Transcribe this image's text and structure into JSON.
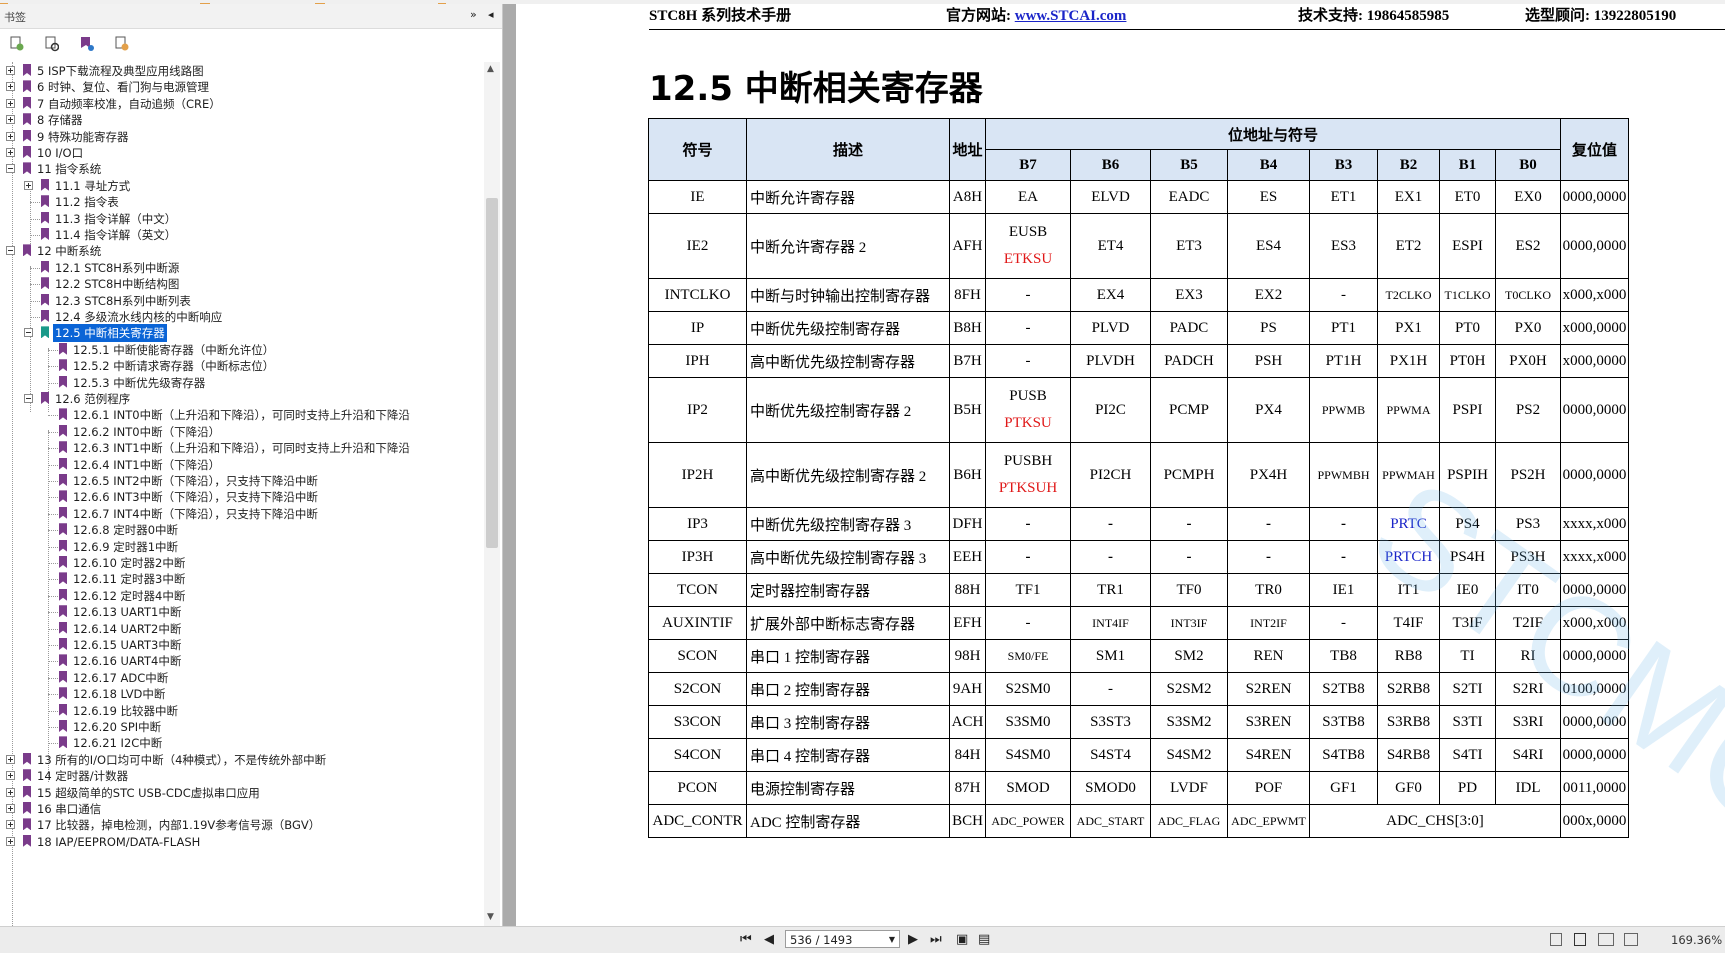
{
  "bookmarks": {
    "title": "书签",
    "collapse_icon": "»",
    "close_icon": "◂",
    "items": [
      {
        "label": "5  ISP下载流程及典型应用线路图"
      },
      {
        "label": "6  时钟、复位、看门狗与电源管理"
      },
      {
        "label": "7  自动频率校准，自动追频（CRE）"
      },
      {
        "label": "8  存储器"
      },
      {
        "label": "9  特殊功能寄存器"
      },
      {
        "label": "10  I/O口"
      },
      {
        "label": "11  指令系统"
      },
      {
        "label": "11.1 寻址方式"
      },
      {
        "label": "11.2 指令表"
      },
      {
        "label": "11.3 指令详解（中文）"
      },
      {
        "label": "11.4 指令详解（英文）"
      },
      {
        "label": "12  中断系统"
      },
      {
        "label": "12.1 STC8H系列中断源"
      },
      {
        "label": "12.2  STC8H中断结构图"
      },
      {
        "label": "12.3  STC8H系列中断列表"
      },
      {
        "label": "12.4  多级流水线内核的中断响应"
      },
      {
        "label": "12.5  中断相关寄存器"
      },
      {
        "label": "12.5.1 中断使能寄存器（中断允许位）"
      },
      {
        "label": "12.5.2 中断请求寄存器（中断标志位）"
      },
      {
        "label": "12.5.3 中断优先级寄存器"
      },
      {
        "label": "12.6  范例程序"
      },
      {
        "label": "12.6.1 INT0中断（上升沿和下降沿），可同时支持上升沿和下降沿"
      },
      {
        "label": "12.6.2 INT0中断（下降沿）"
      },
      {
        "label": "12.6.3 INT1中断（上升沿和下降沿），可同时支持上升沿和下降沿"
      },
      {
        "label": "12.6.4 INT1中断（下降沿）"
      },
      {
        "label": "12.6.5 INT2中断（下降沿），只支持下降沿中断"
      },
      {
        "label": "12.6.6 INT3中断（下降沿），只支持下降沿中断"
      },
      {
        "label": "12.6.7 INT4中断（下降沿），只支持下降沿中断"
      },
      {
        "label": "12.6.8 定时器0中断"
      },
      {
        "label": "12.6.9 定时器1中断"
      },
      {
        "label": "12.6.10 定时器2中断"
      },
      {
        "label": "12.6.11 定时器3中断"
      },
      {
        "label": "12.6.12 定时器4中断"
      },
      {
        "label": "12.6.13 UART1中断"
      },
      {
        "label": "12.6.14 UART2中断"
      },
      {
        "label": "12.6.15 UART3中断"
      },
      {
        "label": "12.6.16 UART4中断"
      },
      {
        "label": "12.6.17 ADC中断"
      },
      {
        "label": "12.6.18 LVD中断"
      },
      {
        "label": "12.6.19 比较器中断"
      },
      {
        "label": "12.6.20 SPI中断"
      },
      {
        "label": "12.6.21 I2C中断"
      },
      {
        "label": "13  所有的I/O口均可中断（4种模式），不是传统外部中断"
      },
      {
        "label": "14  定时器/计数器"
      },
      {
        "label": "15  超级简单的STC USB-CDC虚拟串口应用"
      },
      {
        "label": "16  串口通信"
      },
      {
        "label": "17  比较器，掉电检测，内部1.19V参考信号源（BGV）"
      },
      {
        "label": "18  IAP/EEPROM/DATA-FLASH"
      }
    ]
  },
  "document": {
    "header": {
      "manual": "STC8H 系列技术手册",
      "site_label": "官方网站: ",
      "site_url": "www.STCAI.com",
      "support": "技术支持: 19864585985",
      "advisor": "选型顾问: 13922805190"
    },
    "section_title": "12.5   中断相关寄存器",
    "watermark": "STCMCU",
    "table": {
      "headers": {
        "symbol": "符号",
        "desc": "描述",
        "addr": "地址",
        "bits_group": "位地址与符号",
        "reset": "复位值",
        "bits": [
          "B7",
          "B6",
          "B5",
          "B4",
          "B3",
          "B2",
          "B1",
          "B0"
        ]
      },
      "rows": [
        {
          "sym": "IE",
          "desc": "中断允许寄存器",
          "addr": "A8H",
          "bits": [
            "EA",
            "ELVD",
            "EADC",
            "ES",
            "ET1",
            "EX1",
            "ET0",
            "EX0"
          ],
          "reset": "0000,0000"
        },
        {
          "sym": "IE2",
          "desc": "中断允许寄存器 2",
          "addr": "AFH",
          "b7": "EUSB",
          "b7_red": "ETKSU",
          "bits": [
            "",
            "ET4",
            "ET3",
            "ES4",
            "ES3",
            "ET2",
            "ESPI",
            "ES2"
          ],
          "reset": "0000,0000"
        },
        {
          "sym": "INTCLKO",
          "desc": "中断与时钟输出控制寄存器",
          "addr": "8FH",
          "bits": [
            "-",
            "EX4",
            "EX3",
            "EX2",
            "-",
            "T2CLKO",
            "T1CLKO",
            "T0CLKO"
          ],
          "reset": "x000,x000"
        },
        {
          "sym": "IP",
          "desc": "中断优先级控制寄存器",
          "addr": "B8H",
          "bits": [
            "-",
            "PLVD",
            "PADC",
            "PS",
            "PT1",
            "PX1",
            "PT0",
            "PX0"
          ],
          "reset": "x000,0000"
        },
        {
          "sym": "IPH",
          "desc": "高中断优先级控制寄存器",
          "addr": "B7H",
          "bits": [
            "-",
            "PLVDH",
            "PADCH",
            "PSH",
            "PT1H",
            "PX1H",
            "PT0H",
            "PX0H"
          ],
          "reset": "x000,0000"
        },
        {
          "sym": "IP2",
          "desc": "中断优先级控制寄存器 2",
          "addr": "B5H",
          "b7": "PUSB",
          "b7_red": "PTKSU",
          "bits": [
            "",
            "PI2C",
            "PCMP",
            "PX4",
            "PPWMB",
            "PPWMA",
            "PSPI",
            "PS2"
          ],
          "reset": "0000,0000"
        },
        {
          "sym": "IP2H",
          "desc": "高中断优先级控制寄存器 2",
          "addr": "B6H",
          "b7": "PUSBH",
          "b7_red": "PTKSUH",
          "bits": [
            "",
            "PI2CH",
            "PCMPH",
            "PX4H",
            "PPWMBH",
            "PPWMAH",
            "PSPIH",
            "PS2H"
          ],
          "reset": "0000,0000"
        },
        {
          "sym": "IP3",
          "desc": "中断优先级控制寄存器 3",
          "addr": "DFH",
          "bits": [
            "-",
            "-",
            "-",
            "-",
            "-",
            "PRTC",
            "PS4",
            "PS3"
          ],
          "reset": "xxxx,x000"
        },
        {
          "sym": "IP3H",
          "desc": "高中断优先级控制寄存器 3",
          "addr": "EEH",
          "bits": [
            "-",
            "-",
            "-",
            "-",
            "-",
            "PRTCH",
            "PS4H",
            "PS3H"
          ],
          "reset": "xxxx,x000"
        },
        {
          "sym": "TCON",
          "desc": "定时器控制寄存器",
          "addr": "88H",
          "bits": [
            "TF1",
            "TR1",
            "TF0",
            "TR0",
            "IE1",
            "IT1",
            "IE0",
            "IT0"
          ],
          "reset": "0000,0000"
        },
        {
          "sym": "AUXINTIF",
          "desc": "扩展外部中断标志寄存器",
          "addr": "EFH",
          "bits": [
            "-",
            "INT4IF",
            "INT3IF",
            "INT2IF",
            "-",
            "T4IF",
            "T3IF",
            "T2IF"
          ],
          "reset": "x000,x000"
        },
        {
          "sym": "SCON",
          "desc": "串口 1 控制寄存器",
          "addr": "98H",
          "bits": [
            "SM0/FE",
            "SM1",
            "SM2",
            "REN",
            "TB8",
            "RB8",
            "TI",
            "RI"
          ],
          "reset": "0000,0000"
        },
        {
          "sym": "S2CON",
          "desc": "串口 2 控制寄存器",
          "addr": "9AH",
          "bits": [
            "S2SM0",
            "-",
            "S2SM2",
            "S2REN",
            "S2TB8",
            "S2RB8",
            "S2TI",
            "S2RI"
          ],
          "reset": "0100,0000"
        },
        {
          "sym": "S3CON",
          "desc": "串口 3 控制寄存器",
          "addr": "ACH",
          "bits": [
            "S3SM0",
            "S3ST3",
            "S3SM2",
            "S3REN",
            "S3TB8",
            "S3RB8",
            "S3TI",
            "S3RI"
          ],
          "reset": "0000,0000"
        },
        {
          "sym": "S4CON",
          "desc": "串口 4 控制寄存器",
          "addr": "84H",
          "bits": [
            "S4SM0",
            "S4ST4",
            "S4SM2",
            "S4REN",
            "S4TB8",
            "S4RB8",
            "S4TI",
            "S4RI"
          ],
          "reset": "0000,0000"
        },
        {
          "sym": "PCON",
          "desc": "电源控制寄存器",
          "addr": "87H",
          "bits": [
            "SMOD",
            "SMOD0",
            "LVDF",
            "POF",
            "GF1",
            "GF0",
            "PD",
            "IDL"
          ],
          "reset": "0011,0000"
        },
        {
          "sym": "ADC_CONTR",
          "desc": "ADC 控制寄存器",
          "addr": "BCH",
          "bits": [
            "ADC_POWER",
            "ADC_START",
            "ADC_FLAG",
            "ADC_EPWMT"
          ],
          "merged": "ADC_CHS[3:0]",
          "reset": "000x,0000"
        }
      ]
    }
  },
  "statusbar": {
    "page_value": "536 / 1493",
    "zoom": "169.36%"
  },
  "colors": {
    "header_fill": "#d9e5f4",
    "selection": "#0a64d6",
    "red_text": "#e01818",
    "blue_text": "#1a24c8",
    "bookmark_icon": "#7a3b8a"
  }
}
